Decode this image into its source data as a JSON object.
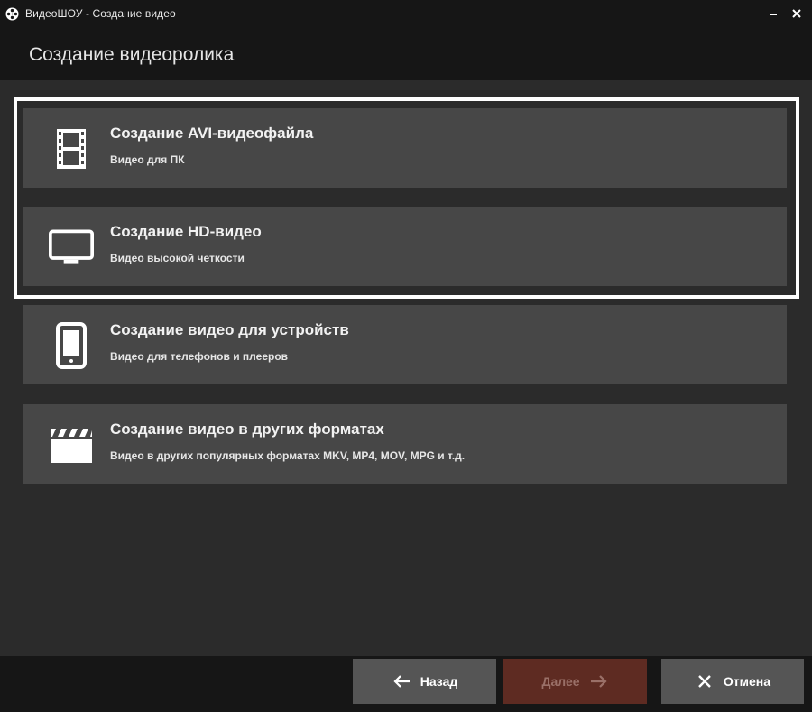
{
  "window": {
    "title": "ВидеоШОУ - Создание видео",
    "minimize_label": "–",
    "close_label": "×"
  },
  "header": {
    "title": "Создание видеоролика"
  },
  "options": [
    {
      "icon": "film-strip-icon",
      "title": "Создание AVI-видеофайла",
      "subtitle": "Видео для ПК"
    },
    {
      "icon": "monitor-icon",
      "title": "Создание HD-видео",
      "subtitle": "Видео высокой четкости"
    },
    {
      "icon": "phone-icon",
      "title": "Создание видео для устройств",
      "subtitle": "Видео для телефонов и плееров"
    },
    {
      "icon": "clapperboard-icon",
      "title": "Создание видео в других форматах",
      "subtitle": "Видео в других популярных форматах MKV, MP4, MOV, MPG и т.д."
    }
  ],
  "footer": {
    "back_label": "Назад",
    "next_label": "Далее",
    "cancel_label": "Отмена"
  },
  "colors": {
    "accent_disabled": "#5e2b22",
    "card_bg": "#474747",
    "highlight_border": "#ffffff"
  }
}
